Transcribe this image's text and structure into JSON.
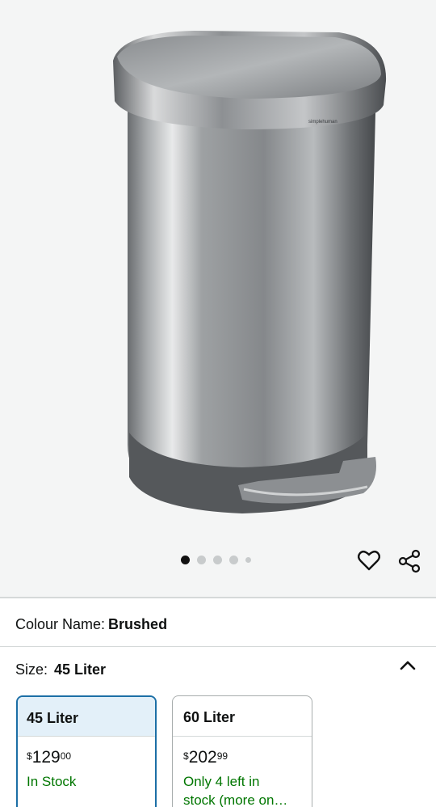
{
  "gallery": {
    "brand_logo_text": "simplehuman",
    "image_alt": "Brushed stainless steel semi-round step trash can",
    "dots_count": 5,
    "active_dot": 0,
    "wishlist_icon": "heart-icon",
    "share_icon": "share-icon"
  },
  "colour": {
    "label": "Colour Name:",
    "value": "Brushed"
  },
  "size": {
    "label": "Size:",
    "value": "45 Liter",
    "toggle_icon": "chevron-up-icon",
    "options": [
      {
        "title": "45 Liter",
        "currency": "$",
        "price_whole": "129",
        "price_fraction": "00",
        "availability": "In Stock",
        "selected": true
      },
      {
        "title": "60 Liter",
        "currency": "$",
        "price_whole": "202",
        "price_fraction": "99",
        "availability_line1": "Only 4 left in",
        "availability_line2": "stock (more on…",
        "selected": false
      }
    ]
  },
  "colors": {
    "selected_border": "#1c6fa6",
    "selected_header_bg": "#e3f0f9",
    "stock_green": "#007600",
    "gallery_bg": "#f4f5f5"
  }
}
